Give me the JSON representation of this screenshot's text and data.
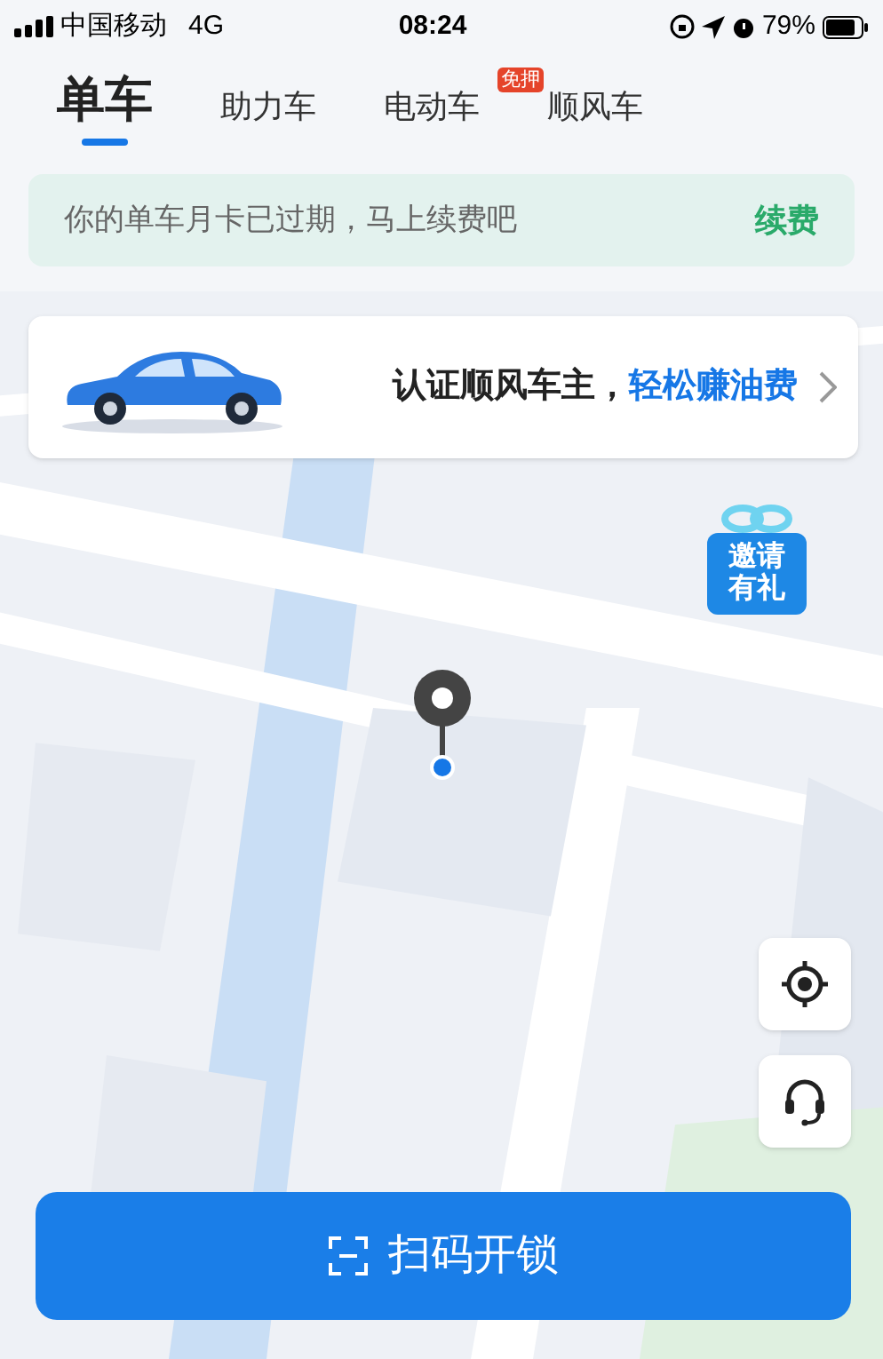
{
  "status_bar": {
    "carrier": "中国移动",
    "network": "4G",
    "time": "08:24",
    "battery": "79%"
  },
  "tabs": [
    {
      "label": "单车",
      "selected": true
    },
    {
      "label": "助力车",
      "selected": false
    },
    {
      "label": "电动车",
      "selected": false,
      "badge": "免押"
    },
    {
      "label": "顺风车",
      "selected": false
    }
  ],
  "notice": {
    "message": "你的单车月卡已过期，马上续费吧",
    "action": "续费"
  },
  "promo": {
    "text": "认证顺风车主，",
    "highlight": "轻松赚油费"
  },
  "gift": {
    "lines": [
      "邀请",
      "有礼"
    ]
  },
  "scan_button": {
    "label": "扫码开锁"
  }
}
